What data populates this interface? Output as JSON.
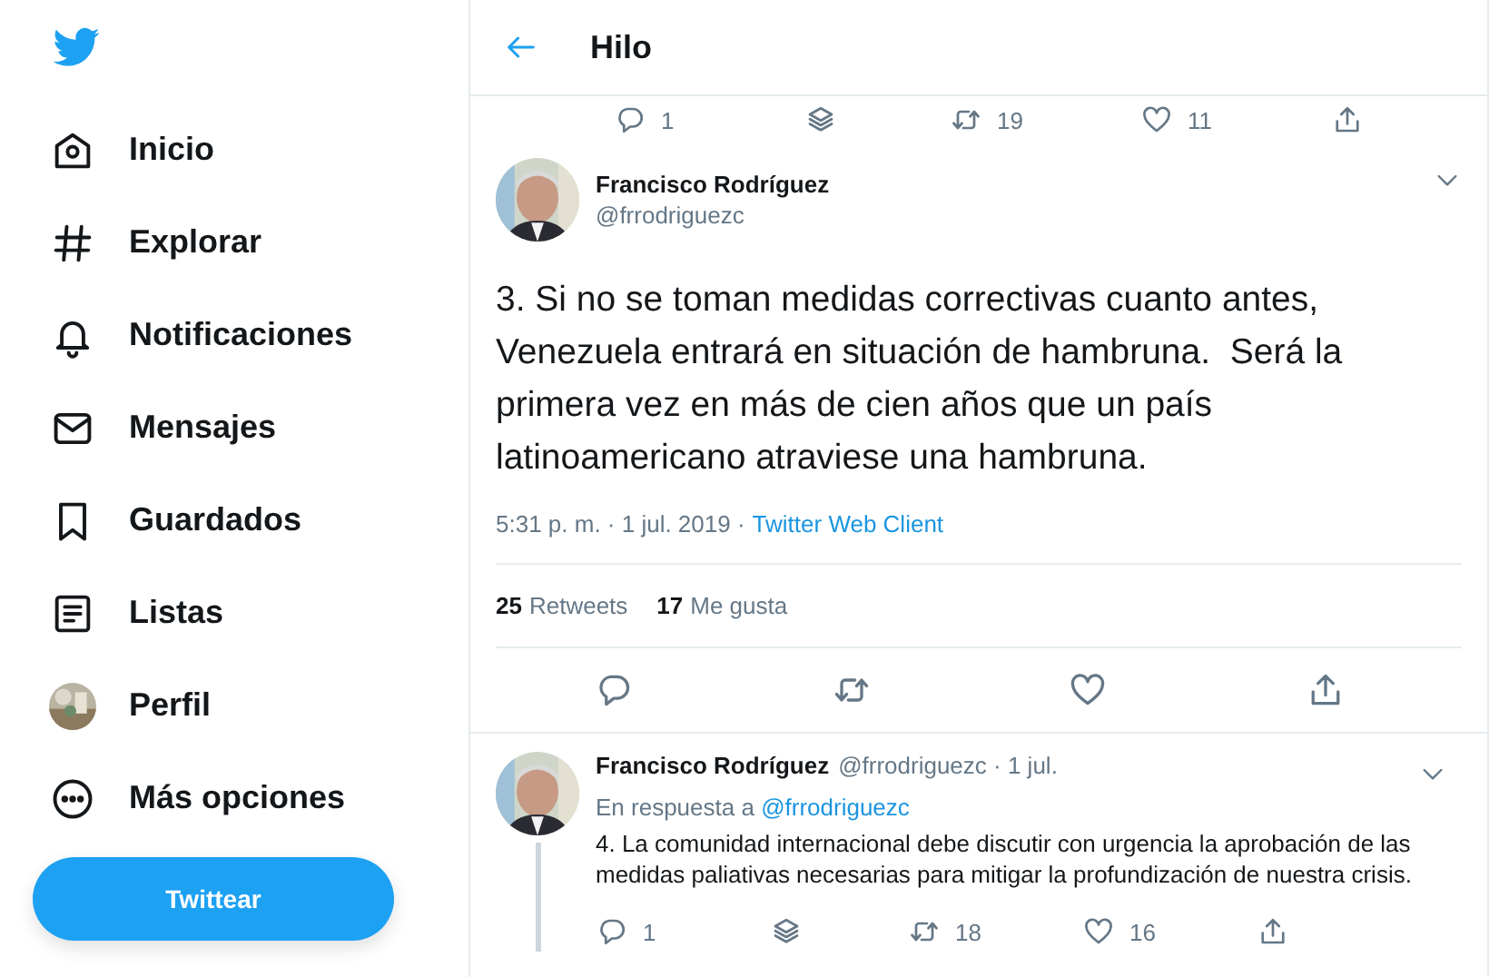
{
  "sidebar": {
    "items": [
      {
        "label": "Inicio",
        "kind": "home"
      },
      {
        "label": "Explorar",
        "kind": "hash"
      },
      {
        "label": "Notificaciones",
        "kind": "bell"
      },
      {
        "label": "Mensajes",
        "kind": "mail"
      },
      {
        "label": "Guardados",
        "kind": "bookmark"
      },
      {
        "label": "Listas",
        "kind": "list"
      },
      {
        "label": "Perfil",
        "kind": "avatar"
      },
      {
        "label": "Más opciones",
        "kind": "more"
      }
    ],
    "tweet_button": "Twittear"
  },
  "header": {
    "title": "Hilo"
  },
  "previous_tweet_actions": [
    {
      "kind": "reply",
      "count": "1"
    },
    {
      "kind": "stack"
    },
    {
      "kind": "retweet",
      "count": "19"
    },
    {
      "kind": "like",
      "count": "11"
    },
    {
      "kind": "share"
    }
  ],
  "main_tweet": {
    "author": "Francisco Rodríguez",
    "handle": "@frrodriguezc",
    "text": "3. Si no se toman medidas correctivas cuanto antes, Venezuela entrará en situación de hambruna.  Será la primera vez en más de cien años que un país latinoamericano atraviese una hambruna.",
    "timestamp": "5:31 p. m. · 1 jul. 2019 ·",
    "source": "Twitter Web Client",
    "retweets_count": "25",
    "retweets_label": "Retweets",
    "likes_count": "17",
    "likes_label": "Me gusta",
    "actions": [
      {
        "kind": "reply"
      },
      {
        "kind": "retweet"
      },
      {
        "kind": "like"
      },
      {
        "kind": "share"
      }
    ]
  },
  "reply_tweet": {
    "author": "Francisco Rodríguez",
    "handle": "@frrodriguezc · 1 jul.",
    "reply_prefix": "En respuesta a",
    "reply_to": "@frrodriguezc",
    "text": "4. La comunidad internacional debe discutir con urgencia la aprobación de las medidas paliativas necesarias para mitigar la profundización de nuestra crisis.",
    "actions": [
      {
        "kind": "reply",
        "count": "1"
      },
      {
        "kind": "stack"
      },
      {
        "kind": "retweet",
        "count": "18"
      },
      {
        "kind": "like",
        "count": "16"
      },
      {
        "kind": "share"
      }
    ]
  }
}
